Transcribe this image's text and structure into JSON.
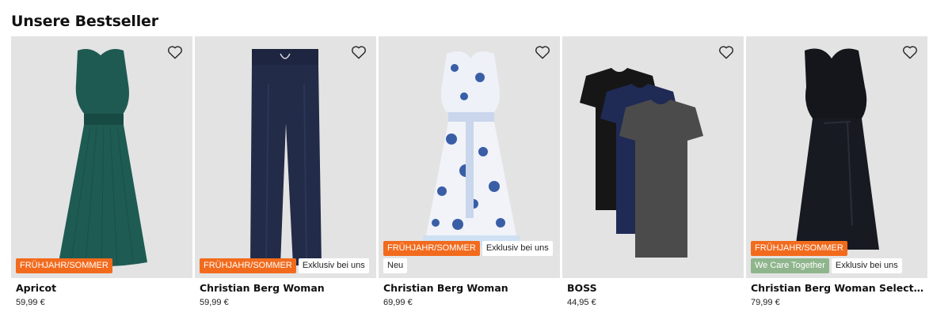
{
  "section": {
    "title": "Unsere Bestseller"
  },
  "products": [
    {
      "brand": "Apricot",
      "price": "59,99 €",
      "image": "green-sleeveless-pleated-dress",
      "badges": [
        {
          "text": "FRÜHJAHR/SOMMER",
          "style": "orange"
        }
      ]
    },
    {
      "brand": "Christian Berg Woman",
      "price": "59,99 €",
      "image": "navy-wide-leg-trousers",
      "badges": [
        {
          "text": "FRÜHJAHR/SOMMER",
          "style": "orange"
        },
        {
          "text": "Exklusiv bei uns",
          "style": "white"
        }
      ]
    },
    {
      "brand": "Christian Berg Woman",
      "price": "69,99 €",
      "image": "blue-floral-shirt-dress",
      "badges": [
        {
          "text": "FRÜHJAHR/SOMMER",
          "style": "orange"
        },
        {
          "text": "Exklusiv bei uns",
          "style": "white"
        },
        {
          "text": "Neu",
          "style": "white"
        }
      ]
    },
    {
      "brand": "BOSS",
      "price": "44,95 €",
      "image": "three-pack-t-shirts",
      "badges": []
    },
    {
      "brand": "Christian Berg Woman Selecti...",
      "price": "79,99 €",
      "image": "black-sleeveless-dress",
      "badges": [
        {
          "text": "FRÜHJAHR/SOMMER",
          "style": "orange"
        },
        {
          "text": "We Care Together",
          "style": "green"
        },
        {
          "text": "Exklusiv bei uns",
          "style": "white"
        }
      ]
    }
  ],
  "icons": {
    "wishlist": "heart-outline-icon"
  },
  "colors": {
    "badge_orange": "#f26b1d",
    "badge_green": "#8fb58d",
    "image_background": "#e3e3e3"
  }
}
